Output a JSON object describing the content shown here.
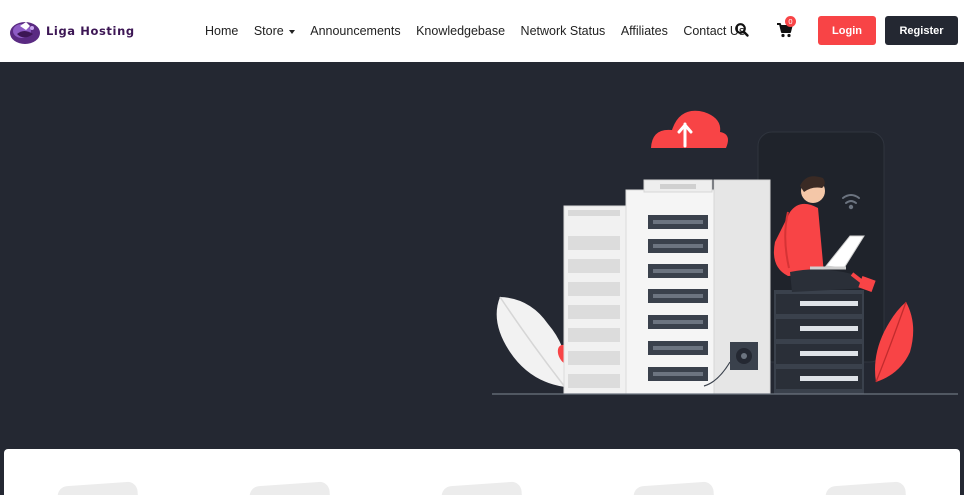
{
  "brand": {
    "name": "Liga Hosting"
  },
  "nav": {
    "items": [
      {
        "label": "Home"
      },
      {
        "label": "Store",
        "has_dropdown": true
      },
      {
        "label": "Announcements"
      },
      {
        "label": "Knowledgebase"
      },
      {
        "label": "Network Status"
      },
      {
        "label": "Affiliates"
      },
      {
        "label": "Contact Us"
      }
    ],
    "search_icon": "search-icon",
    "cart_icon": "shopping-cart-icon",
    "cart_count": "0",
    "login_label": "Login",
    "register_label": "Register"
  },
  "colors": {
    "accent": "#f84446",
    "dark": "#242832",
    "white": "#ffffff",
    "brand_purple": "#3c1654"
  }
}
